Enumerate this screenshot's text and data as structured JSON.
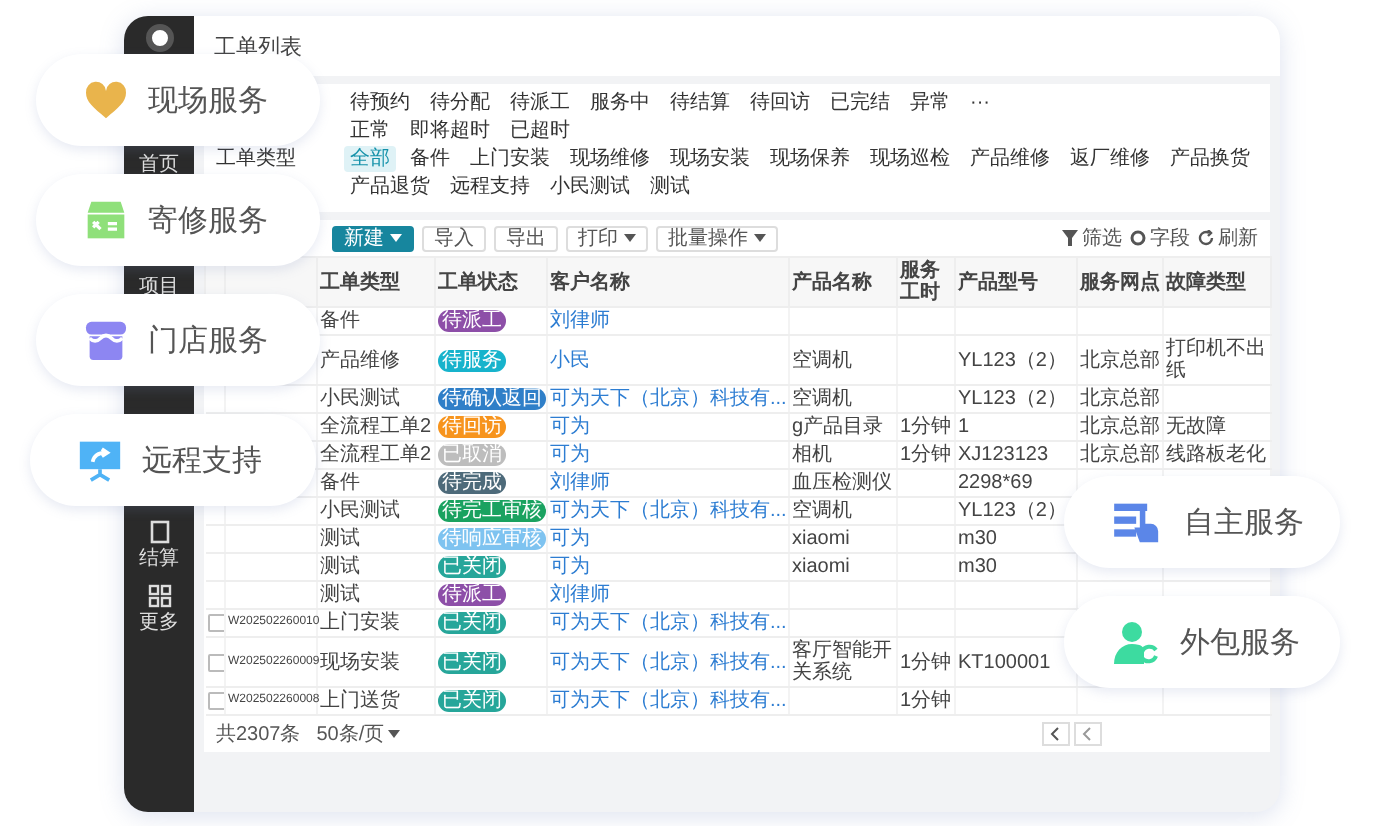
{
  "pills": [
    {
      "kind": "heart",
      "label": "现场服务",
      "color": "#e9b44c"
    },
    {
      "kind": "repair",
      "label": "寄修服务",
      "color": "#8fe07a"
    },
    {
      "kind": "store",
      "label": "门店服务",
      "color": "#8d86f2"
    },
    {
      "kind": "remote",
      "label": "远程支持",
      "color": "#4fb3f6"
    },
    {
      "kind": "self",
      "label": "自主服务",
      "color": "#5b86e8"
    },
    {
      "kind": "outsource",
      "label": "外包服务",
      "color": "#3ddba0"
    }
  ],
  "app": {
    "title": "工单列表",
    "sidebar": [
      {
        "kind": "home",
        "label": "首页"
      },
      {
        "kind": "project",
        "label": "项目"
      },
      {
        "kind": "settle",
        "label": "结算"
      },
      {
        "kind": "more",
        "label": "更多"
      }
    ],
    "filters": [
      {
        "options": [
          {
            "label": "待预约",
            "selected": false
          },
          {
            "label": "待分配",
            "selected": false
          },
          {
            "label": "待派工",
            "selected": false
          },
          {
            "label": "服务中",
            "selected": false
          },
          {
            "label": "待结算",
            "selected": false
          },
          {
            "label": "待回访",
            "selected": false
          },
          {
            "label": "已完结",
            "selected": false
          },
          {
            "label": "异常",
            "selected": false
          },
          {
            "label": "···",
            "selected": false
          }
        ]
      },
      {
        "options": [
          {
            "label": "正常",
            "selected": false
          },
          {
            "label": "即将超时",
            "selected": false
          },
          {
            "label": "已超时",
            "selected": false
          }
        ]
      },
      {
        "label": "工单类型",
        "options": [
          {
            "label": "全部",
            "selected": true
          },
          {
            "label": "备件",
            "selected": false
          },
          {
            "label": "上门安装",
            "selected": false
          },
          {
            "label": "现场维修",
            "selected": false
          },
          {
            "label": "现场安装",
            "selected": false
          },
          {
            "label": "现场保养",
            "selected": false
          },
          {
            "label": "现场巡检",
            "selected": false
          },
          {
            "label": "产品维修",
            "selected": false
          },
          {
            "label": "返厂维修",
            "selected": false
          },
          {
            "label": "产品换货",
            "selected": false
          },
          {
            "label": "产品退货",
            "selected": false
          },
          {
            "label": "远程支持",
            "selected": false
          },
          {
            "label": "小民测试",
            "selected": false
          },
          {
            "label": "测试",
            "selected": false
          }
        ]
      }
    ],
    "toolbar": {
      "buttons": [
        {
          "kind": "primary",
          "label": "新建"
        },
        {
          "kind": "plain",
          "label": "导入"
        },
        {
          "kind": "plain",
          "label": "导出"
        },
        {
          "kind": "dropdown",
          "label": "打印"
        },
        {
          "kind": "dropdown",
          "label": "批量操作"
        }
      ],
      "tools": [
        {
          "kind": "filter",
          "label": "筛选"
        },
        {
          "kind": "fields",
          "label": "字段"
        },
        {
          "kind": "refresh",
          "label": "刷新"
        }
      ]
    },
    "table": {
      "columns": [
        {
          "kind": "number"
        },
        {
          "label": "工单类型",
          "kind": "text"
        },
        {
          "label": "工单状态",
          "kind": "status"
        },
        {
          "label": "客户名称",
          "kind": "link"
        },
        {
          "label": "产品名称",
          "kind": "text"
        },
        {
          "label": "服务工时",
          "kind": "text"
        },
        {
          "label": "产品型号",
          "kind": "text"
        },
        {
          "label": "服务网点",
          "kind": "text"
        },
        {
          "label": "故障类型",
          "kind": "text"
        }
      ],
      "rows": [
        {
          "cells": [
            null,
            "备件",
            {
              "label": "待派工",
              "color": "#8d4fa8"
            },
            "刘律师",
            null,
            null,
            null,
            null,
            null
          ]
        },
        {
          "cells": [
            null,
            "产品维修",
            {
              "label": "待服务",
              "color": "#17b3cc"
            },
            "小民",
            "空调机",
            null,
            "YL123（2）",
            "北京总部",
            "打印机不出纸"
          ]
        },
        {
          "cells": [
            null,
            "小民测试",
            {
              "label": "待确认返回",
              "color": "#2f7fc8"
            },
            "可为天下（北京）科技有...",
            "空调机",
            null,
            "YL123（2）",
            "北京总部",
            null
          ]
        },
        {
          "cells": [
            null,
            "全流程工单2",
            {
              "label": "待回访",
              "color": "#f7941d"
            },
            "可为",
            "g产品目录",
            "1分钟",
            "1",
            "北京总部",
            "无故障"
          ]
        },
        {
          "cells": [
            null,
            "全流程工单2",
            {
              "label": "已取消",
              "color": "#bdbdbd"
            },
            "可为",
            "相机",
            "1分钟",
            "XJ123123",
            "北京总部",
            "线路板老化"
          ]
        },
        {
          "cells": [
            null,
            "备件",
            {
              "label": "待完成",
              "color": "#4d6a7a"
            },
            "刘律师",
            "血压检测仪",
            null,
            "2298*69",
            null,
            null
          ]
        },
        {
          "cells": [
            null,
            "小民测试",
            {
              "label": "待完工审核",
              "color": "#1aa260"
            },
            "可为天下（北京）科技有...",
            "空调机",
            null,
            "YL123（2）",
            null,
            null
          ]
        },
        {
          "cells": [
            null,
            "测试",
            {
              "label": "待响应审核",
              "color": "#7ec3f0"
            },
            "可为",
            "xiaomi",
            null,
            "m30",
            null,
            null
          ]
        },
        {
          "cells": [
            null,
            "测试",
            {
              "label": "已关闭",
              "color": "#26a69a"
            },
            "可为",
            "xiaomi",
            null,
            "m30",
            null,
            null
          ]
        },
        {
          "cells": [
            null,
            "测试",
            {
              "label": "待派工",
              "color": "#8d4fa8"
            },
            "刘律师",
            null,
            null,
            null,
            null,
            null
          ]
        },
        {
          "checked": false,
          "cells": [
            "W202502260010",
            "上门安装",
            {
              "label": "已关闭",
              "color": "#26a69a"
            },
            "可为天下（北京）科技有...",
            null,
            null,
            null,
            null,
            null
          ]
        },
        {
          "checked": false,
          "cells": [
            "W202502260009",
            "现场安装",
            {
              "label": "已关闭",
              "color": "#26a69a"
            },
            "可为天下（北京）科技有...",
            "客厅智能开关系统",
            "1分钟",
            "KT100001",
            null,
            null
          ]
        },
        {
          "checked": false,
          "cells": [
            "W202502260008",
            "上门送货",
            {
              "label": "已关闭",
              "color": "#26a69a"
            },
            "可为天下（北京）科技有...",
            null,
            "1分钟",
            null,
            null,
            null
          ]
        }
      ]
    },
    "footer": {
      "total": "共2307条",
      "page_size": "50条/页"
    }
  }
}
